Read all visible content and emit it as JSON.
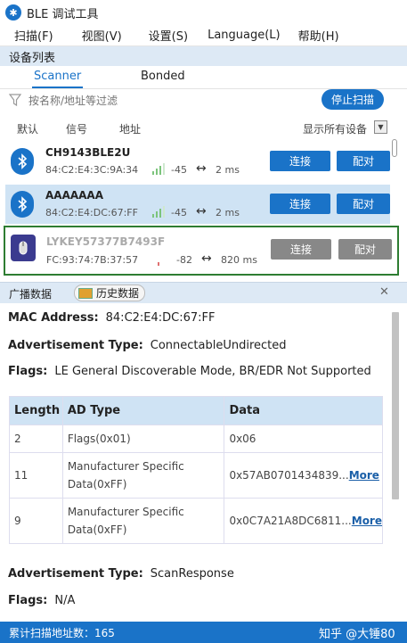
{
  "window": {
    "title": "BLE 调试工具"
  },
  "menu": [
    "扫描(F)",
    "视图(V)",
    "设置(S)",
    "Language(L)",
    "帮助(H)"
  ],
  "device_list": {
    "header": "设备列表",
    "tabs": [
      "Scanner",
      "Bonded"
    ],
    "filter_placeholder": "按名称/地址等过滤",
    "stop_button": "停止扫描",
    "columns": {
      "default": "默认",
      "signal": "信号",
      "address": "地址",
      "show_all": "显示所有设备"
    },
    "connect_label": "连接",
    "pair_label": "配对",
    "devices": [
      {
        "name": "CH9143BLE2U",
        "mac": "84:C2:E4:3C:9A:34",
        "rssi": "-45",
        "interval": "2 ms"
      },
      {
        "name": "AAAAAAA",
        "mac": "84:C2:E4:DC:67:FF",
        "rssi": "-45",
        "interval": "2 ms"
      },
      {
        "name": "LYKEY57377B7493F",
        "mac": "FC:93:74:7B:37:57",
        "rssi": "-82",
        "interval": "820 ms"
      }
    ]
  },
  "detail": {
    "tab_broadcast": "广播数据",
    "tab_history": "历史数据",
    "mac_label": "MAC Address:",
    "mac_value": "84:C2:E4:DC:67:FF",
    "adv_type_label": "Advertisement Type:",
    "adv_type_value": "ConnectableUndirected",
    "flags_label": "Flags:",
    "flags_value": "LE General Discoverable Mode, BR/EDR Not Supported",
    "table_headers": [
      "Length",
      "AD Type",
      "Data"
    ],
    "rows": [
      {
        "length": "2",
        "type": "Flags(0x01)",
        "data": "0x06",
        "more": ""
      },
      {
        "length": "11",
        "type": "Manufacturer Specific Data(0xFF)",
        "data": "0x57AB0701434839...",
        "more": "More"
      },
      {
        "length": "9",
        "type": "Manufacturer Specific Data(0xFF)",
        "data": "0x0C7A21A8DC6811...",
        "more": "More"
      }
    ],
    "adv_type2_label": "Advertisement Type:",
    "adv_type2_value": "ScanResponse",
    "flags2_label": "Flags:",
    "flags2_value": "N/A"
  },
  "status": {
    "text": "累计扫描地址数：165",
    "watermark": "知乎 @大锤80"
  },
  "colors": {
    "accent": "#1a73c8",
    "selected_row": "#cfe3f4",
    "highlight_border": "#2e7d32"
  }
}
